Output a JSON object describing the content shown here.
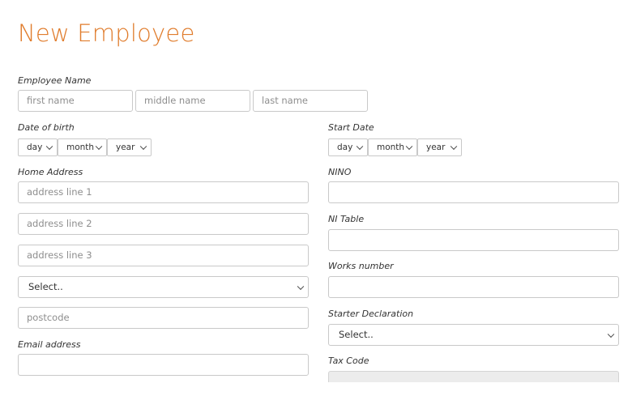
{
  "page": {
    "title": "New Employee"
  },
  "employee_name": {
    "label": "Employee Name",
    "first_placeholder": "first name",
    "middle_placeholder": "middle name",
    "last_placeholder": "last name"
  },
  "dob": {
    "label": "Date of birth",
    "day": "day",
    "month": "month",
    "year": "year"
  },
  "start_date": {
    "label": "Start Date",
    "day": "day",
    "month": "month",
    "year": "year"
  },
  "home_address": {
    "label": "Home Address",
    "line1_placeholder": "address line 1",
    "line2_placeholder": "address line 2",
    "line3_placeholder": "address line 3",
    "country_select": "Select..",
    "postcode_placeholder": "postcode"
  },
  "email": {
    "label": "Email address",
    "value": ""
  },
  "nino": {
    "label": "NINO",
    "value": ""
  },
  "ni_table": {
    "label": "NI Table",
    "value": ""
  },
  "works_number": {
    "label": "Works number",
    "value": ""
  },
  "starter_declaration": {
    "label": "Starter Declaration",
    "select": "Select.."
  },
  "tax_code": {
    "label": "Tax Code",
    "value": ""
  },
  "colors": {
    "accent": "#e07c2c",
    "border": "#c9c9c9",
    "disabled_bg": "#ececec"
  }
}
